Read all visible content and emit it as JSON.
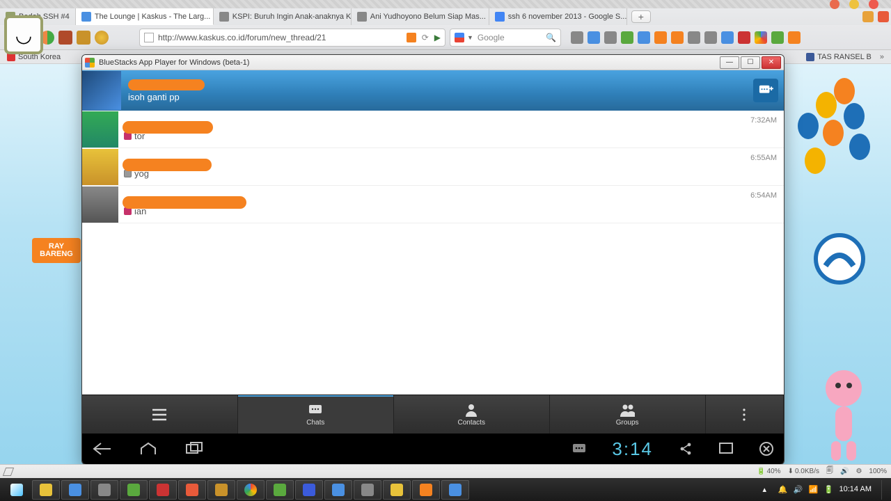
{
  "browser": {
    "tabs": [
      {
        "label": "Bedah SSH #4",
        "favicon": "#94a06a"
      },
      {
        "label": "The Lounge | Kaskus - The Larg...",
        "favicon": "#4a90e2",
        "active": true,
        "closable": true
      },
      {
        "label": "KSPI: Buruh Ingin Anak-anaknya Ku...",
        "favicon": "#888"
      },
      {
        "label": "Ani Yudhoyono Belum Siap Mas...",
        "favicon": "#888"
      },
      {
        "label": "ssh 6 november 2013 - Google S...",
        "favicon": "#4285f4"
      }
    ],
    "address": "http://www.kaskus.co.id/forum/new_thread/21",
    "search_placeholder": "Google",
    "bookmarks": [
      {
        "label": "South Korea",
        "favicon": "#d33"
      },
      {
        "label": "TAS RANSEL B",
        "favicon": "#3b5998"
      }
    ]
  },
  "bluestacks": {
    "title": "BlueStacks App Player for Windows (beta-1)",
    "header_status": "isoh ganti pp",
    "chats": [
      {
        "snippet": "tor",
        "time": "7:32AM",
        "scribble_w": 130,
        "statcol": "#c6316a"
      },
      {
        "snippet": "yog",
        "time": "6:55AM",
        "scribble_w": 128,
        "statcol": "#999"
      },
      {
        "snippet": "ian",
        "time": "6:54AM",
        "scribble_w": 178,
        "statcol": "#c6316a"
      }
    ],
    "tabs": {
      "chats": "Chats",
      "contacts": "Contacts",
      "groups": "Groups"
    },
    "android_clock": "3:14"
  },
  "desktop": {
    "ribbon_line1": "RAY",
    "ribbon_line2": "BARENG"
  },
  "statusbar": {
    "battery": "40%",
    "speed": "0.0KB/s",
    "zoom": "100%"
  },
  "system": {
    "time": "10:14 AM"
  }
}
